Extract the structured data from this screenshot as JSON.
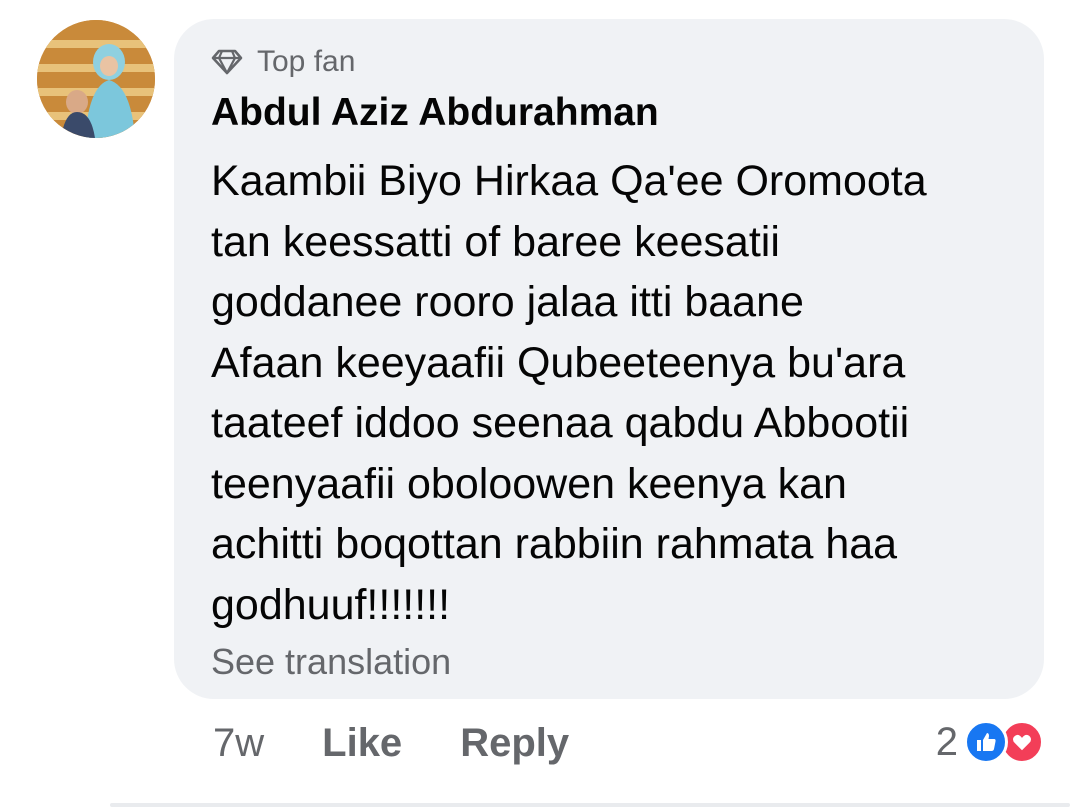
{
  "comment": {
    "badge": "Top fan",
    "badge_icon": "diamond-icon",
    "author": "Abdul Aziz Abdurahman",
    "text": "Kaambii Biyo Hirkaa Qa'ee Oromoota\ntan keessatti of baree keesatii\ngoddanee rooro jalaa itti baane\nAfaan keeyaafii Qubeeteenya bu'ara\ntaateef iddoo seenaa qabdu Abbootii\nteenyaafii oboloowen keenya kan\nachitti boqottan rabbiin rahmata haa\ngodhuuf!!!!!!!",
    "see_translation": "See translation",
    "time": "7w",
    "like_label": "Like",
    "reply_label": "Reply",
    "reaction_count": "2",
    "reactions": [
      "like-reaction-icon",
      "love-reaction-icon"
    ]
  },
  "colors": {
    "bubble_bg": "#f0f2f5",
    "secondary_text": "#65676b",
    "primary_text": "#050505",
    "like_blue": "#1877f2",
    "love_red": "#f33e58"
  }
}
